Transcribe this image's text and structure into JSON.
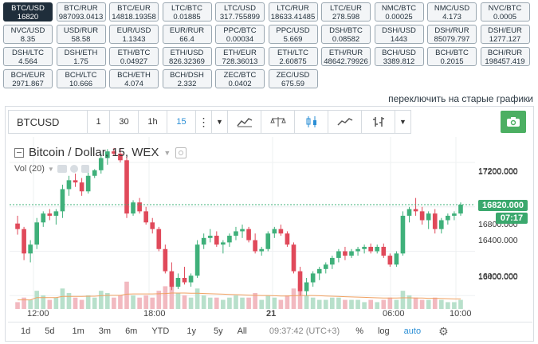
{
  "pairs": [
    {
      "name": "BTC/USD",
      "price": "16820",
      "active": true
    },
    {
      "name": "BTC/RUR",
      "price": "987093.0413"
    },
    {
      "name": "BTC/EUR",
      "price": "14818.19358"
    },
    {
      "name": "LTC/BTC",
      "price": "0.01885"
    },
    {
      "name": "LTC/USD",
      "price": "317.755899"
    },
    {
      "name": "LTC/RUR",
      "price": "18633.41485"
    },
    {
      "name": "LTC/EUR",
      "price": "278.598"
    },
    {
      "name": "NMC/BTC",
      "price": "0.00025"
    },
    {
      "name": "NMC/USD",
      "price": "4.173"
    },
    {
      "name": "NVC/BTC",
      "price": "0.0005"
    },
    {
      "name": "NVC/USD",
      "price": "8.35"
    },
    {
      "name": "USD/RUR",
      "price": "58.58"
    },
    {
      "name": "EUR/USD",
      "price": "1.1343"
    },
    {
      "name": "EUR/RUR",
      "price": "66.4"
    },
    {
      "name": "PPC/BTC",
      "price": "0.00034"
    },
    {
      "name": "PPC/USD",
      "price": "5.669"
    },
    {
      "name": "DSH/BTC",
      "price": "0.08582"
    },
    {
      "name": "DSH/USD",
      "price": "1443"
    },
    {
      "name": "DSH/RUR",
      "price": "85079.797"
    },
    {
      "name": "DSH/EUR",
      "price": "1277.127"
    },
    {
      "name": "DSH/LTC",
      "price": "4.564"
    },
    {
      "name": "DSH/ETH",
      "price": "1.75"
    },
    {
      "name": "ETH/BTC",
      "price": "0.04927"
    },
    {
      "name": "ETH/USD",
      "price": "826.32369"
    },
    {
      "name": "ETH/EUR",
      "price": "728.36013"
    },
    {
      "name": "ETH/LTC",
      "price": "2.60875"
    },
    {
      "name": "ETH/RUR",
      "price": "48642.79926"
    },
    {
      "name": "BCH/USD",
      "price": "3389.812"
    },
    {
      "name": "BCH/BTC",
      "price": "0.2015"
    },
    {
      "name": "BCH/RUR",
      "price": "198457.419"
    },
    {
      "name": "BCH/EUR",
      "price": "2971.867"
    },
    {
      "name": "BCH/LTC",
      "price": "10.666"
    },
    {
      "name": "BCH/ETH",
      "price": "4.074"
    },
    {
      "name": "BCH/DSH",
      "price": "2.332"
    },
    {
      "name": "ZEC/BTC",
      "price": "0.0402"
    },
    {
      "name": "ZEC/USD",
      "price": "675.59"
    }
  ],
  "switch_link": "переключить на старые графики",
  "toolbar": {
    "symbol": "BTCUSD",
    "intervals": [
      "1",
      "30",
      "1h",
      "15"
    ],
    "selected_interval": "15"
  },
  "legend": {
    "title": "Bitcoin / Dollar, 15, WEX",
    "vol": "Vol (20)"
  },
  "price_axis": {
    "ticks": [
      "17200.000",
      "16800.000",
      "16400.000",
      "16000.000"
    ],
    "current_price": "16820.000",
    "countdown": "07:17"
  },
  "time_axis": {
    "ticks": [
      "12:00",
      "18:00",
      "21",
      "06:00",
      "10:00"
    ]
  },
  "bottom": {
    "ranges": [
      "1d",
      "5d",
      "1m",
      "3m",
      "6m",
      "YTD",
      "1y",
      "5y",
      "All"
    ],
    "time": "09:37:42 (UTC+3)",
    "percent": "%",
    "log": "log",
    "auto": "auto"
  },
  "colors": {
    "up": "#3fb07a",
    "down": "#e0495a",
    "vol_up": "#b8e0cb",
    "vol_down": "#f2b9c0",
    "ma": "#f0a060",
    "accent": "#2b8fd6"
  },
  "chart_data": {
    "type": "candlestick",
    "symbol": "BTCUSD",
    "interval": "15",
    "ylim": [
      15880,
      17430
    ],
    "yticks": [
      16000,
      16400,
      16800,
      17200
    ],
    "last_price": 16820,
    "candles": [
      {
        "o": 16650,
        "h": 16720,
        "l": 16550,
        "c": 16600
      },
      {
        "o": 16600,
        "h": 16620,
        "l": 16320,
        "c": 16380
      },
      {
        "o": 16380,
        "h": 16500,
        "l": 16300,
        "c": 16460
      },
      {
        "o": 16460,
        "h": 16700,
        "l": 16420,
        "c": 16660
      },
      {
        "o": 16660,
        "h": 16760,
        "l": 16620,
        "c": 16740
      },
      {
        "o": 16740,
        "h": 16780,
        "l": 16680,
        "c": 16720
      },
      {
        "o": 16720,
        "h": 16780,
        "l": 16640,
        "c": 16760
      },
      {
        "o": 16760,
        "h": 17000,
        "l": 16700,
        "c": 16960
      },
      {
        "o": 16960,
        "h": 17080,
        "l": 16900,
        "c": 17040
      },
      {
        "o": 17040,
        "h": 17100,
        "l": 16980,
        "c": 17020
      },
      {
        "o": 17020,
        "h": 17060,
        "l": 16900,
        "c": 16940
      },
      {
        "o": 16940,
        "h": 17120,
        "l": 16920,
        "c": 17080
      },
      {
        "o": 17080,
        "h": 17140,
        "l": 17060,
        "c": 17130
      },
      {
        "o": 17130,
        "h": 17280,
        "l": 17100,
        "c": 17240
      },
      {
        "o": 17240,
        "h": 17320,
        "l": 17180,
        "c": 17300
      },
      {
        "o": 17300,
        "h": 17330,
        "l": 17260,
        "c": 17280
      },
      {
        "o": 17280,
        "h": 17330,
        "l": 17200,
        "c": 17220
      },
      {
        "o": 17220,
        "h": 17260,
        "l": 16700,
        "c": 16740
      },
      {
        "o": 16740,
        "h": 16860,
        "l": 16720,
        "c": 16840
      },
      {
        "o": 16840,
        "h": 16880,
        "l": 16740,
        "c": 16760
      },
      {
        "o": 16760,
        "h": 16800,
        "l": 16640,
        "c": 16660
      },
      {
        "o": 16660,
        "h": 16700,
        "l": 16560,
        "c": 16600
      },
      {
        "o": 16600,
        "h": 16620,
        "l": 16400,
        "c": 16420
      },
      {
        "o": 16420,
        "h": 16460,
        "l": 16200,
        "c": 16220
      },
      {
        "o": 16220,
        "h": 16300,
        "l": 16050,
        "c": 16080
      },
      {
        "o": 16080,
        "h": 16200,
        "l": 16060,
        "c": 16160
      },
      {
        "o": 16160,
        "h": 16260,
        "l": 16100,
        "c": 16120
      },
      {
        "o": 16120,
        "h": 16200,
        "l": 16080,
        "c": 16180
      },
      {
        "o": 16180,
        "h": 16500,
        "l": 16160,
        "c": 16460
      },
      {
        "o": 16460,
        "h": 16560,
        "l": 16420,
        "c": 16520
      },
      {
        "o": 16520,
        "h": 16600,
        "l": 16480,
        "c": 16540
      },
      {
        "o": 16540,
        "h": 16580,
        "l": 16440,
        "c": 16460
      },
      {
        "o": 16460,
        "h": 16500,
        "l": 16380,
        "c": 16480
      },
      {
        "o": 16480,
        "h": 16560,
        "l": 16440,
        "c": 16540
      },
      {
        "o": 16540,
        "h": 16620,
        "l": 16500,
        "c": 16580
      },
      {
        "o": 16580,
        "h": 16640,
        "l": 16520,
        "c": 16600
      },
      {
        "o": 16600,
        "h": 16620,
        "l": 16480,
        "c": 16500
      },
      {
        "o": 16500,
        "h": 16560,
        "l": 16380,
        "c": 16400
      },
      {
        "o": 16400,
        "h": 16440,
        "l": 16360,
        "c": 16420
      },
      {
        "o": 16420,
        "h": 16580,
        "l": 16400,
        "c": 16560
      },
      {
        "o": 16560,
        "h": 16620,
        "l": 16520,
        "c": 16600
      },
      {
        "o": 16600,
        "h": 16640,
        "l": 16540,
        "c": 16560
      },
      {
        "o": 16560,
        "h": 16580,
        "l": 16440,
        "c": 16460
      },
      {
        "o": 16460,
        "h": 16480,
        "l": 16200,
        "c": 16220
      },
      {
        "o": 16220,
        "h": 16260,
        "l": 16000,
        "c": 16040
      },
      {
        "o": 16040,
        "h": 16160,
        "l": 16000,
        "c": 16120
      },
      {
        "o": 16120,
        "h": 16220,
        "l": 16080,
        "c": 16200
      },
      {
        "o": 16200,
        "h": 16260,
        "l": 16140,
        "c": 16240
      },
      {
        "o": 16240,
        "h": 16300,
        "l": 16200,
        "c": 16280
      },
      {
        "o": 16280,
        "h": 16360,
        "l": 16240,
        "c": 16340
      },
      {
        "o": 16340,
        "h": 16420,
        "l": 16300,
        "c": 16400
      },
      {
        "o": 16400,
        "h": 16440,
        "l": 16320,
        "c": 16360
      },
      {
        "o": 16360,
        "h": 16420,
        "l": 16340,
        "c": 16400
      },
      {
        "o": 16400,
        "h": 16440,
        "l": 16360,
        "c": 16420
      },
      {
        "o": 16420,
        "h": 16460,
        "l": 16380,
        "c": 16440
      },
      {
        "o": 16440,
        "h": 16470,
        "l": 16380,
        "c": 16400
      },
      {
        "o": 16400,
        "h": 16460,
        "l": 16380,
        "c": 16440
      },
      {
        "o": 16440,
        "h": 16470,
        "l": 16340,
        "c": 16360
      },
      {
        "o": 16360,
        "h": 16380,
        "l": 16260,
        "c": 16280
      },
      {
        "o": 16280,
        "h": 16400,
        "l": 16260,
        "c": 16380
      },
      {
        "o": 16380,
        "h": 16760,
        "l": 16360,
        "c": 16720
      },
      {
        "o": 16720,
        "h": 16800,
        "l": 16660,
        "c": 16780
      },
      {
        "o": 16780,
        "h": 16880,
        "l": 16720,
        "c": 16760
      },
      {
        "o": 16760,
        "h": 16800,
        "l": 16640,
        "c": 16680
      },
      {
        "o": 16680,
        "h": 16760,
        "l": 16600,
        "c": 16740
      },
      {
        "o": 16740,
        "h": 16780,
        "l": 16560,
        "c": 16600
      },
      {
        "o": 16600,
        "h": 16700,
        "l": 16560,
        "c": 16680
      },
      {
        "o": 16680,
        "h": 16740,
        "l": 16640,
        "c": 16720
      },
      {
        "o": 16720,
        "h": 16760,
        "l": 16680,
        "c": 16740
      },
      {
        "o": 16740,
        "h": 16840,
        "l": 16720,
        "c": 16820
      }
    ],
    "volumes": [
      3,
      5,
      4,
      8,
      6,
      4,
      5,
      9,
      7,
      5,
      4,
      6,
      5,
      8,
      7,
      5,
      6,
      12,
      6,
      5,
      6,
      5,
      8,
      10,
      12,
      7,
      6,
      5,
      9,
      6,
      5,
      5,
      4,
      5,
      6,
      5,
      5,
      7,
      4,
      6,
      5,
      4,
      6,
      9,
      11,
      6,
      5,
      4,
      4,
      5,
      5,
      4,
      4,
      4,
      3,
      4,
      3,
      4,
      5,
      4,
      8,
      6,
      5,
      4,
      4,
      5,
      4,
      3,
      3,
      4
    ],
    "ma": [
      4,
      4,
      4,
      5,
      5,
      5,
      5,
      5.5,
      5.5,
      5.5,
      5.5,
      5.6,
      5.6,
      5.8,
      6,
      6,
      6,
      6.5,
      6.6,
      6.6,
      6.6,
      6.6,
      6.7,
      6.8,
      7,
      7,
      7,
      6.9,
      6.9,
      6.8,
      6.7,
      6.6,
      6.5,
      6.4,
      6.3,
      6.2,
      6.1,
      6,
      5.9,
      5.9,
      5.8,
      5.7,
      5.7,
      5.8,
      5.9,
      5.9,
      5.9,
      5.8,
      5.7,
      5.6,
      5.5,
      5.4,
      5.3,
      5.2,
      5.1,
      5,
      4.9,
      4.8,
      4.8,
      4.8,
      4.9,
      4.9,
      4.8,
      4.8,
      4.7,
      4.7,
      4.6,
      4.5,
      4.4,
      4.4
    ]
  }
}
